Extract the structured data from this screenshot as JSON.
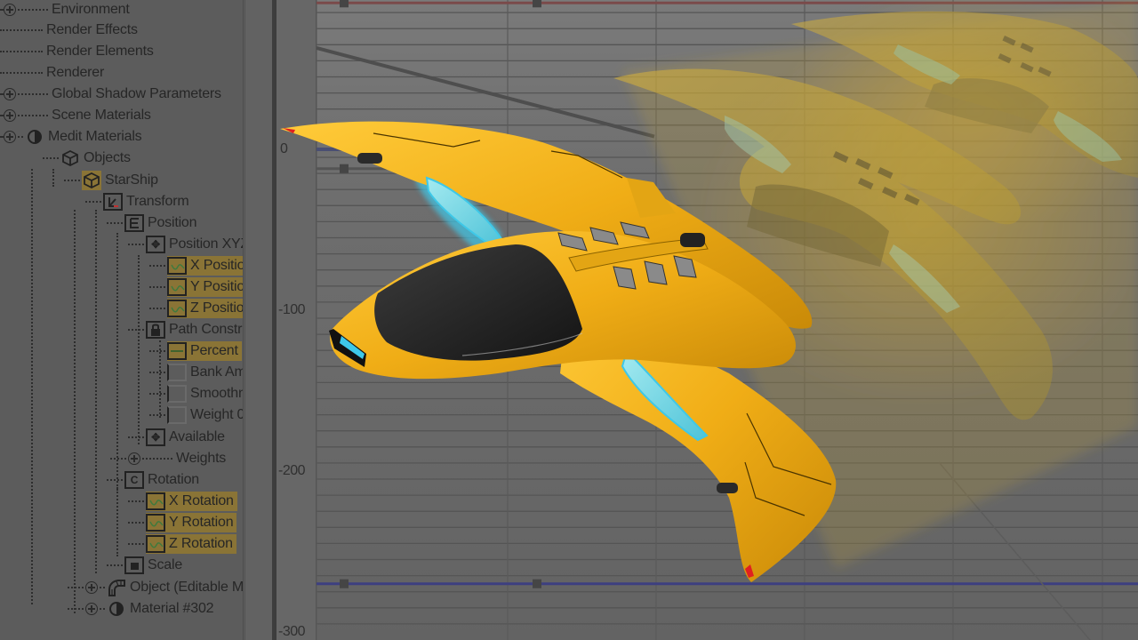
{
  "tree": {
    "items": [
      {
        "label": "Environment",
        "expander": true,
        "icon": "none",
        "highlight": false
      },
      {
        "label": "Render Effects",
        "expander": false,
        "icon": "none",
        "highlight": false
      },
      {
        "label": "Render Elements",
        "expander": false,
        "icon": "none",
        "highlight": false
      },
      {
        "label": "Renderer",
        "expander": false,
        "icon": "none",
        "highlight": false
      },
      {
        "label": "Global Shadow Parameters",
        "expander": true,
        "icon": "none",
        "highlight": false
      },
      {
        "label": "Scene Materials",
        "expander": true,
        "icon": "none",
        "highlight": false
      },
      {
        "label": "Medit Materials",
        "expander": true,
        "icon": "material-sphere",
        "highlight": false
      },
      {
        "label": "Objects",
        "expander": false,
        "icon": "object-box",
        "highlight": false
      },
      {
        "label": "StarShip",
        "expander": false,
        "icon": "object-box",
        "highlight": true
      },
      {
        "label": "Transform",
        "expander": false,
        "icon": "transform-axes",
        "highlight": false
      },
      {
        "label": "Position",
        "expander": false,
        "icon": "position-list",
        "highlight": false
      },
      {
        "label": "Position XYZ",
        "expander": false,
        "icon": "move-arrows",
        "highlight": false
      },
      {
        "label": "X Position",
        "expander": false,
        "icon": "curve",
        "highlight": true
      },
      {
        "label": "Y Position",
        "expander": false,
        "icon": "curve",
        "highlight": true
      },
      {
        "label": "Z Position",
        "expander": false,
        "icon": "curve",
        "highlight": true
      },
      {
        "label": "Path Constrair",
        "expander": false,
        "icon": "lock",
        "highlight": false
      },
      {
        "label": "Percent",
        "expander": false,
        "icon": "percent-line",
        "highlight": true
      },
      {
        "label": "Bank Amou",
        "expander": false,
        "icon": "empty-track",
        "highlight": false
      },
      {
        "label": "Smoothnes",
        "expander": false,
        "icon": "empty-track",
        "highlight": false
      },
      {
        "label": "Weight 0",
        "expander": false,
        "icon": "empty-track",
        "highlight": false
      },
      {
        "label": "Available",
        "expander": false,
        "icon": "move-arrows",
        "highlight": false
      },
      {
        "label": "Weights",
        "expander": true,
        "icon": "none",
        "highlight": false
      },
      {
        "label": "Rotation",
        "expander": false,
        "icon": "rotation",
        "highlight": false
      },
      {
        "label": "X Rotation",
        "expander": false,
        "icon": "curve",
        "highlight": true
      },
      {
        "label": "Y Rotation",
        "expander": false,
        "icon": "curve",
        "highlight": true
      },
      {
        "label": "Z Rotation",
        "expander": false,
        "icon": "curve",
        "highlight": true
      },
      {
        "label": "Scale",
        "expander": false,
        "icon": "scale",
        "highlight": false
      },
      {
        "label": "Object (Editable Mesl",
        "expander": true,
        "icon": "mesh-pipe",
        "highlight": false
      },
      {
        "label": "Material #302",
        "expander": true,
        "icon": "material-sphere",
        "highlight": false
      }
    ]
  },
  "ruler": {
    "ticks": [
      "0",
      "-100",
      "-200",
      "-300"
    ],
    "tick_values": [
      0,
      -100,
      -200,
      -300
    ]
  },
  "graph": {
    "curves": [
      {
        "name": "red-curve",
        "color": "#7a4a4a",
        "value_range": [
          91,
          91
        ]
      },
      {
        "name": "gray-curve",
        "color": "#4e4e4e",
        "value_range": [
          63,
          8
        ]
      },
      {
        "name": "navy-curve",
        "color": "#4a4f73",
        "value_range": [
          0,
          0
        ]
      },
      {
        "name": "dark-gray-curve",
        "color": "#555555",
        "value_range": [
          -12,
          -12
        ]
      },
      {
        "name": "blue-curve",
        "color": "#3d3f80",
        "value_range": [
          -270,
          -270
        ]
      }
    ]
  },
  "colors": {
    "highlight": "#8a7436",
    "ship_yellow": "#f1b21c",
    "glow_cyan": "#3ec8e8"
  }
}
